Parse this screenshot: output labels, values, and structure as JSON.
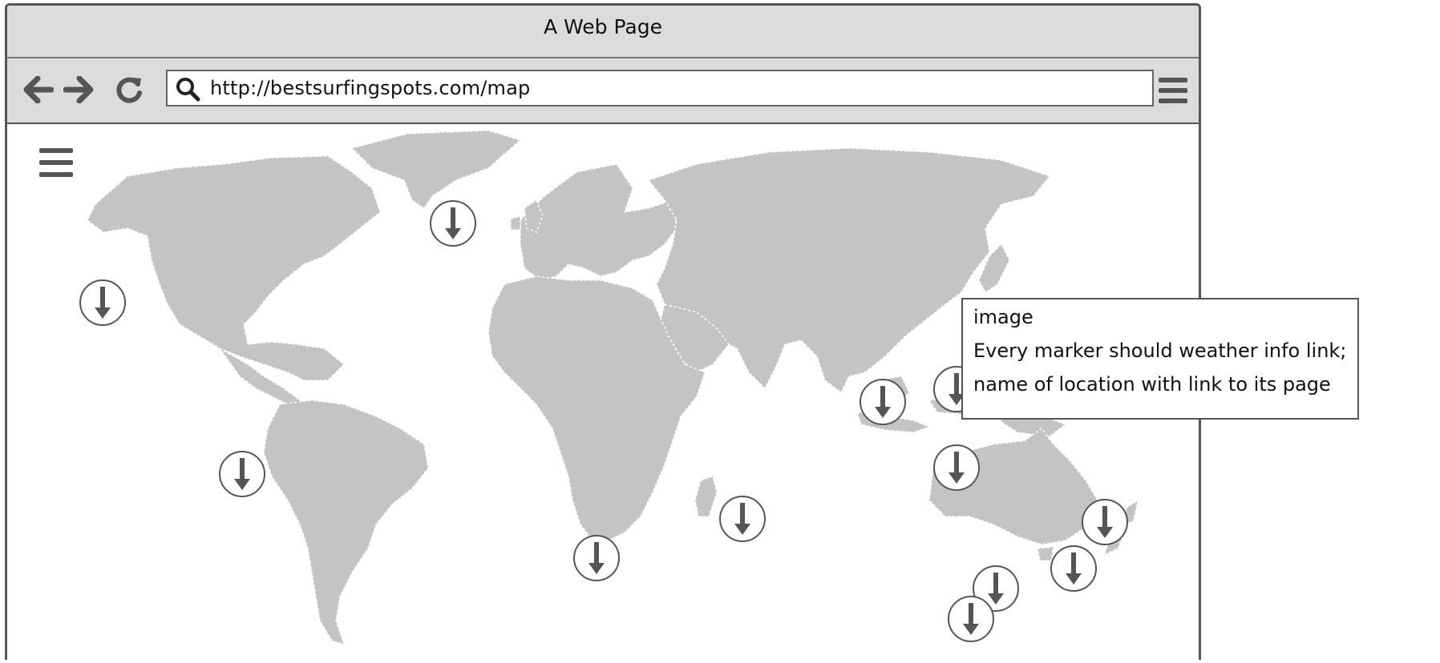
{
  "window": {
    "title": "A Web Page"
  },
  "navigation": {
    "back_icon": "arrow-left-icon",
    "forward_icon": "arrow-right-icon",
    "reload_icon": "reload-icon",
    "url": "http://bestsurfingspots.com/map",
    "search_icon": "search-icon",
    "menu_icon": "hamburger-menu-icon"
  },
  "page": {
    "menu_icon": "hamburger-menu-icon",
    "map_image": "world-map",
    "marker_icon": "arrow-down-marker-icon",
    "marker_count": 12
  },
  "note": {
    "title": "image",
    "lines": [
      "Every marker should weather info link;",
      "name of location with link to its page"
    ]
  },
  "colors": {
    "chrome": "#dcdcdc",
    "land": "#c4c4c4",
    "marker_arrow": "#555555",
    "border": "#555555"
  }
}
